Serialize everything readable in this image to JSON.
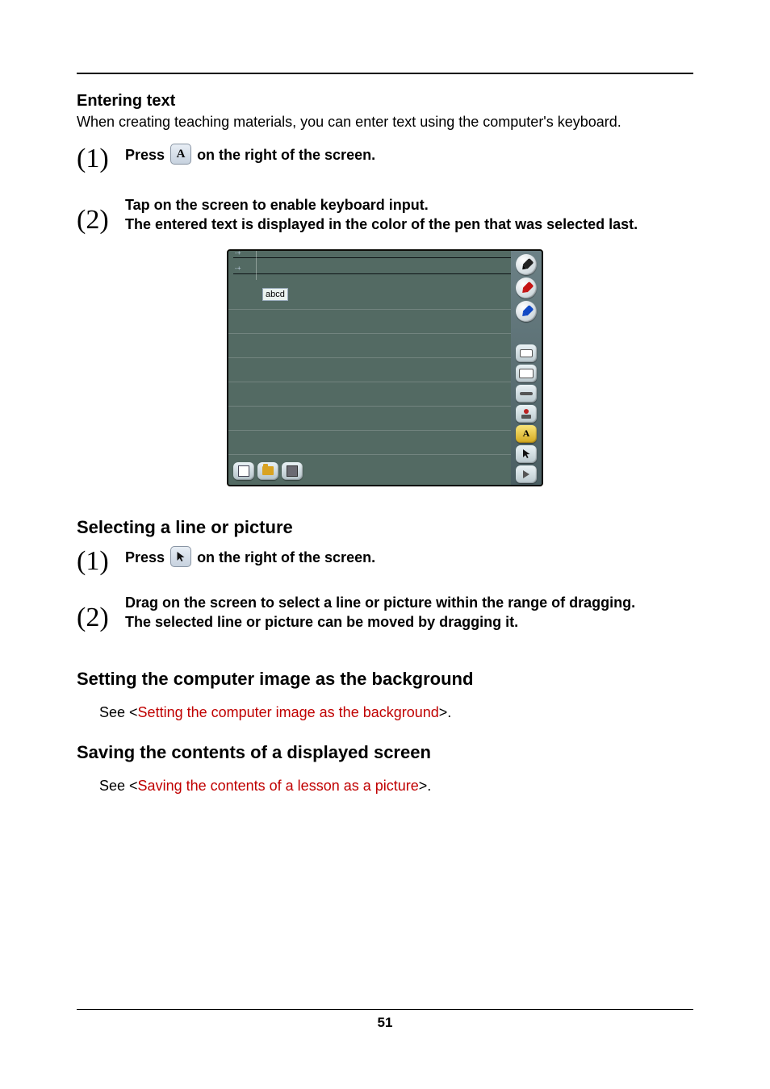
{
  "page_number": "51",
  "entering_text": {
    "heading": "Entering text",
    "description": "When creating teaching materials, you can enter text using the computer's keyboard.",
    "steps": {
      "1": {
        "num": "(1)",
        "t1": "Press ",
        "icon_glyph": "A",
        "t2": " on the right of the screen."
      },
      "2": {
        "num": "(2)",
        "line1": "Tap on the screen to enable keyboard input.",
        "line2": "The entered text is displayed in the color of the pen that was selected last."
      }
    },
    "figure": {
      "typed_text": "abcd",
      "text_tool_glyph": "A"
    }
  },
  "selecting": {
    "heading": "Selecting a line or picture",
    "steps": {
      "1": {
        "num": "(1)",
        "t1": "Press ",
        "t2": " on the right of the screen."
      },
      "2": {
        "num": "(2)",
        "line1": "Drag on the screen to select a line or picture within the range of dragging.",
        "line2": "The selected line or picture can be moved by dragging it."
      }
    }
  },
  "bg": {
    "heading": "Setting the computer image as the background",
    "see_pre": "See <",
    "link": "Setting the computer image as the background",
    "see_post": ">."
  },
  "saving": {
    "heading": "Saving the contents of a displayed screen",
    "see_pre": "See <",
    "link": "Saving the contents of a lesson as a picture",
    "see_post": ">."
  }
}
